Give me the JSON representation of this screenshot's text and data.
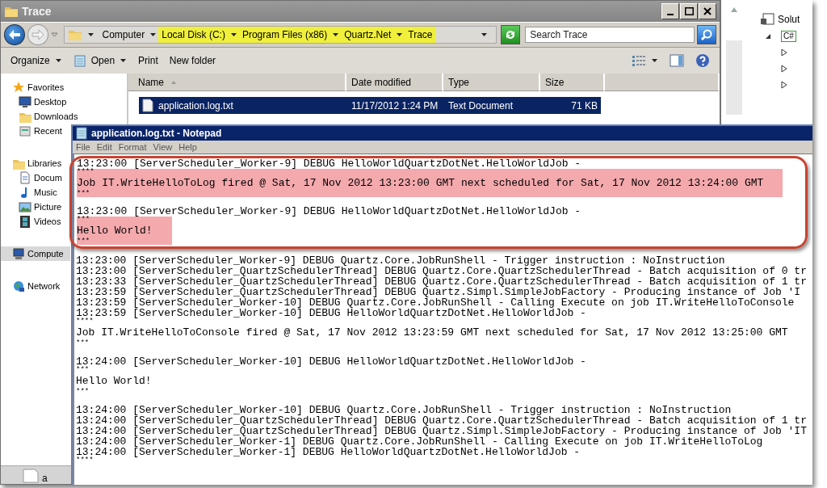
{
  "explorer": {
    "title": "Trace",
    "breadcrumb": [
      {
        "label": "Computer",
        "highlighted": false
      },
      {
        "label": "Local Disk (C:)",
        "highlighted": true
      },
      {
        "label": "Program Files (x86)",
        "highlighted": true
      },
      {
        "label": "Quartz.Net",
        "highlighted": true
      },
      {
        "label": "Trace",
        "highlighted": true
      }
    ],
    "search": {
      "placeholder": "Search Trace"
    },
    "toolbar": [
      {
        "label": "Organize",
        "kind": "menu"
      },
      {
        "label": "Open",
        "kind": "open"
      },
      {
        "label": "Print",
        "kind": "plain"
      },
      {
        "label": "New folder",
        "kind": "plain"
      }
    ],
    "nav": [
      {
        "label": "Favorites",
        "kind": "favorites",
        "selected": false,
        "children": [
          {
            "label": "Desktop",
            "kind": "desktop",
            "selected": false
          },
          {
            "label": "Downloads",
            "kind": "downloads",
            "selected": false
          },
          {
            "label": "Recent",
            "kind": "recent",
            "selected": false
          }
        ]
      },
      {
        "label": "Libraries",
        "kind": "libraries",
        "selected": false,
        "children": [
          {
            "label": "Docum",
            "kind": "documents",
            "selected": false
          },
          {
            "label": "Music",
            "kind": "music",
            "selected": false
          },
          {
            "label": "Picture",
            "kind": "pictures",
            "selected": false
          },
          {
            "label": "Videos",
            "kind": "videos",
            "selected": false
          }
        ]
      },
      {
        "label": "Compute",
        "kind": "computer",
        "selected": true
      },
      {
        "label": "Network",
        "kind": "network",
        "selected": false
      }
    ],
    "columns": [
      "Name",
      "Date modified",
      "Type",
      "Size"
    ],
    "files": [
      {
        "name": "application.log.txt",
        "date_modified": "11/17/2012 1:24 PM",
        "type": "Text Document",
        "size": "71 KB",
        "selected": true
      }
    ],
    "details_label": "a"
  },
  "side_panel": {
    "items": [
      {
        "label": "Solut",
        "kind": "solution"
      },
      {
        "label": "C#",
        "kind": "project"
      }
    ]
  },
  "notepad": {
    "title": "application.log.txt - Notepad",
    "menu": [
      "File",
      "Edit",
      "Format",
      "View",
      "Help"
    ],
    "annotated_blocks": [
      {
        "lines": [
          {
            "kind": "log",
            "text": "13:23:00 [ServerScheduler_Worker-9] DEBUG HelloWorldQuartzDotNet.HelloWorldJob -",
            "highlighted": false
          },
          {
            "kind": "stars",
            "text": "****",
            "highlighted": true
          },
          {
            "kind": "message",
            "text": "Job IT.WriteHelloToLog fired @ Sat, 17 Nov 2012 13:23:00 GMT next scheduled for Sat, 17 Nov 2012 13:24:00 GMT",
            "highlighted": true
          },
          {
            "kind": "stars",
            "text": "***",
            "highlighted": true
          }
        ]
      },
      {
        "lines": [
          {
            "kind": "log",
            "text": "13:23:00 [ServerScheduler_Worker-9] DEBUG HelloWorldQuartzDotNet.HelloWorldJob -",
            "highlighted": false
          },
          {
            "kind": "stars",
            "text": "***",
            "highlighted": true
          },
          {
            "kind": "message",
            "text": "Hello World!",
            "highlighted": true
          },
          {
            "kind": "stars",
            "text": "***",
            "highlighted": true
          }
        ]
      }
    ],
    "blocks": [
      {
        "lines": [
          {
            "kind": "log",
            "text": "13:23:00 [ServerScheduler_Worker-9] DEBUG Quartz.Core.JobRunShell - Trigger instruction : NoInstruction",
            "highlighted": false
          },
          {
            "kind": "log",
            "text": "13:23:00 [ServerScheduler_QuartzSchedulerThread] DEBUG Quartz.Core.QuartzSchedulerThread - Batch acquisition of 0 tr",
            "highlighted": false
          },
          {
            "kind": "log",
            "text": "13:23:33 [ServerScheduler_QuartzSchedulerThread] DEBUG Quartz.Core.QuartzSchedulerThread - Batch acquisition of 1 tr",
            "highlighted": false
          },
          {
            "kind": "log",
            "text": "13:23:59 [ServerScheduler_QuartzSchedulerThread] DEBUG Quartz.Simpl.SimpleJobFactory - Producing instance of Job 'I",
            "highlighted": false
          },
          {
            "kind": "log",
            "text": "13:23:59 [ServerScheduler_Worker-10] DEBUG Quartz.Core.JobRunShell - Calling Execute on job IT.WriteHelloToConsole",
            "highlighted": false
          },
          {
            "kind": "log",
            "text": "13:23:59 [ServerScheduler_Worker-10] DEBUG HelloWorldQuartzDotNet.HelloWorldJob -",
            "highlighted": false
          },
          {
            "kind": "stars",
            "text": "****",
            "highlighted": false
          },
          {
            "kind": "message",
            "text": "Job IT.WriteHelloToConsole fired @ Sat, 17 Nov 2012 13:23:59 GMT next scheduled for Sat, 17 Nov 2012 13:25:00 GMT",
            "highlighted": false
          },
          {
            "kind": "stars",
            "text": "***",
            "highlighted": false
          }
        ]
      },
      {
        "lines": [
          {
            "kind": "log",
            "text": "13:24:00 [ServerScheduler_Worker-10] DEBUG HelloWorldQuartzDotNet.HelloWorldJob -",
            "highlighted": false
          },
          {
            "kind": "stars",
            "text": "***",
            "highlighted": false
          },
          {
            "kind": "message",
            "text": "Hello World!",
            "highlighted": false
          },
          {
            "kind": "stars",
            "text": "***",
            "highlighted": false
          }
        ]
      },
      {
        "lines": [
          {
            "kind": "log",
            "text": "13:24:00 [ServerScheduler_Worker-10] DEBUG Quartz.Core.JobRunShell - Trigger instruction : NoInstruction",
            "highlighted": false
          },
          {
            "kind": "log",
            "text": "13:24:00 [ServerScheduler_QuartzSchedulerThread] DEBUG Quartz.Core.QuartzSchedulerThread - Batch acquisition of 1 tr",
            "highlighted": false
          },
          {
            "kind": "log",
            "text": "13:24:00 [ServerScheduler_QuartzSchedulerThread] DEBUG Quartz.Simpl.SimpleJobFactory - Producing instance of Job 'IT",
            "highlighted": false
          },
          {
            "kind": "log",
            "text": "13:24:00 [ServerScheduler_Worker-1] DEBUG Quartz.Core.JobRunShell - Calling Execute on job IT.WriteHelloToLog",
            "highlighted": false
          },
          {
            "kind": "log",
            "text": "13:24:00 [ServerScheduler_Worker-1] DEBUG HelloWorldQuartzDotNet.HelloWorldJob -",
            "highlighted": false
          },
          {
            "kind": "stars",
            "text": "****",
            "highlighted": false
          }
        ]
      }
    ]
  }
}
